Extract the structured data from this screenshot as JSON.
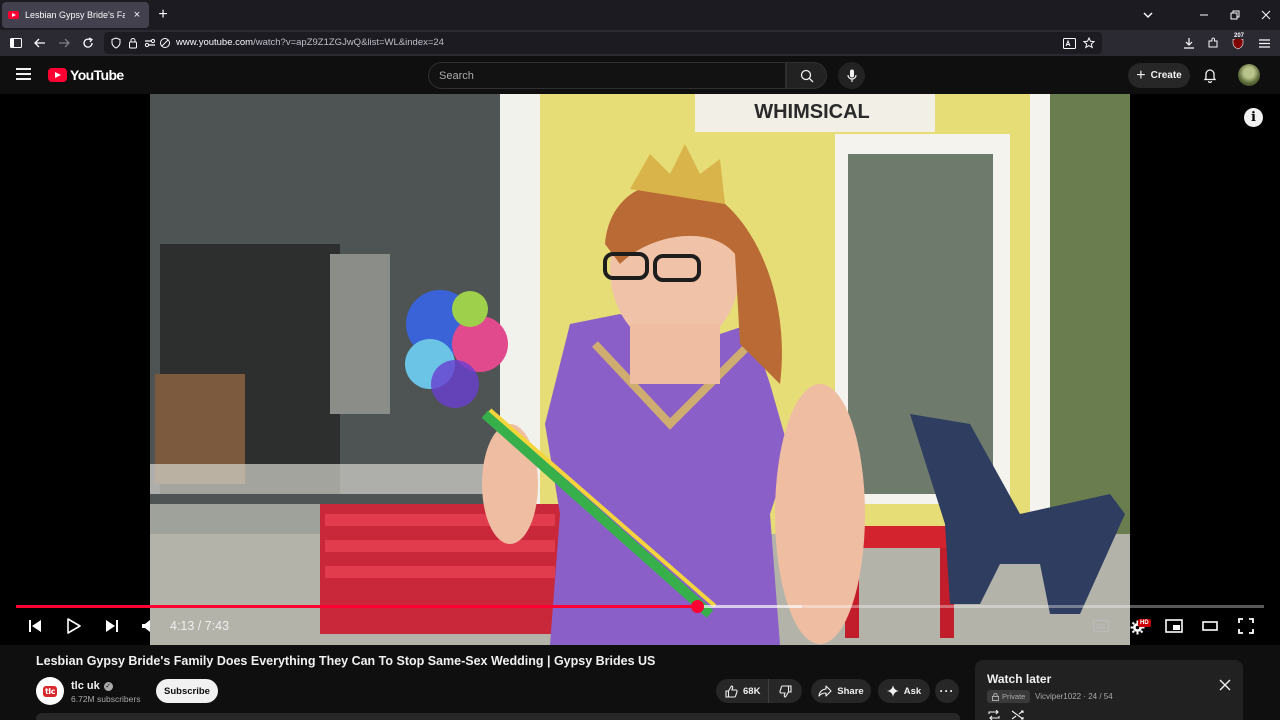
{
  "browser": {
    "tab_title": "Lesbian Gypsy Bride's Family Do",
    "tab_close": "×",
    "new_tab": "+",
    "url_host": "www.youtube.com",
    "url_path": "/watch?v=apZ9Z1ZGJwQ&list=WL&index=24",
    "extensions_badge": "207"
  },
  "header": {
    "logo_text": "YouTube",
    "search_placeholder": "Search",
    "create_label": "Create"
  },
  "player": {
    "current_time": "4:13",
    "duration": "7:43",
    "time_display": "4:13 / 7:43",
    "progress_fraction": 0.546,
    "buffered_fraction": 0.63,
    "hd_badge": "HD",
    "info_glyph": "i",
    "storefront_sign": "WHIMSICAL"
  },
  "video": {
    "title": "Lesbian Gypsy Bride's Family Does Everything They Can To Stop Same-Sex Wedding | Gypsy Brides US",
    "channel_logo": "tlc",
    "channel_name": "tlc uk",
    "verified_glyph": "✓",
    "subscribers": "6.72M subscribers",
    "subscribe_label": "Subscribe",
    "likes": "68K",
    "share_label": "Share",
    "ask_label": "Ask",
    "more_glyph": "···"
  },
  "watch_later": {
    "title": "Watch later",
    "privacy": "Private",
    "owner_position": "Vicviper1022 · 24 / 54"
  },
  "colors": {
    "brand_red": "#ff0033",
    "page_bg": "#0f0f0f",
    "chrome_bg": "#1c1b22"
  }
}
